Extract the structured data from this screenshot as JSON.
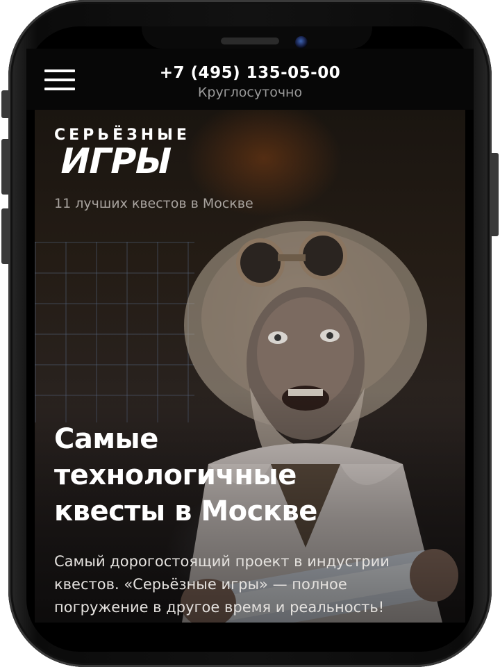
{
  "header": {
    "phone": "+7 (495) 135-05-00",
    "hours": "Круглосуточно"
  },
  "brand": {
    "logo_top": "СЕРЬЁЗНЫЕ",
    "logo_bottom": "ИГРЫ",
    "tagline": "11 лучших квестов в Москве"
  },
  "hero": {
    "headline_lines": [
      "Самые",
      "технологичные",
      "квесты в Москве"
    ],
    "lead": "Самый дорогостоящий проект в индустрии квестов. «Серьёзные игры» — полное погружение в другое время и реальность!",
    "image": "mad-scientist-with-goggles-holding-glowing-tube"
  },
  "icons": {
    "menu": "hamburger-menu-icon"
  },
  "colors": {
    "header_bg": "#070707",
    "text_primary": "#ffffff",
    "text_muted": "#9a9a9a"
  }
}
